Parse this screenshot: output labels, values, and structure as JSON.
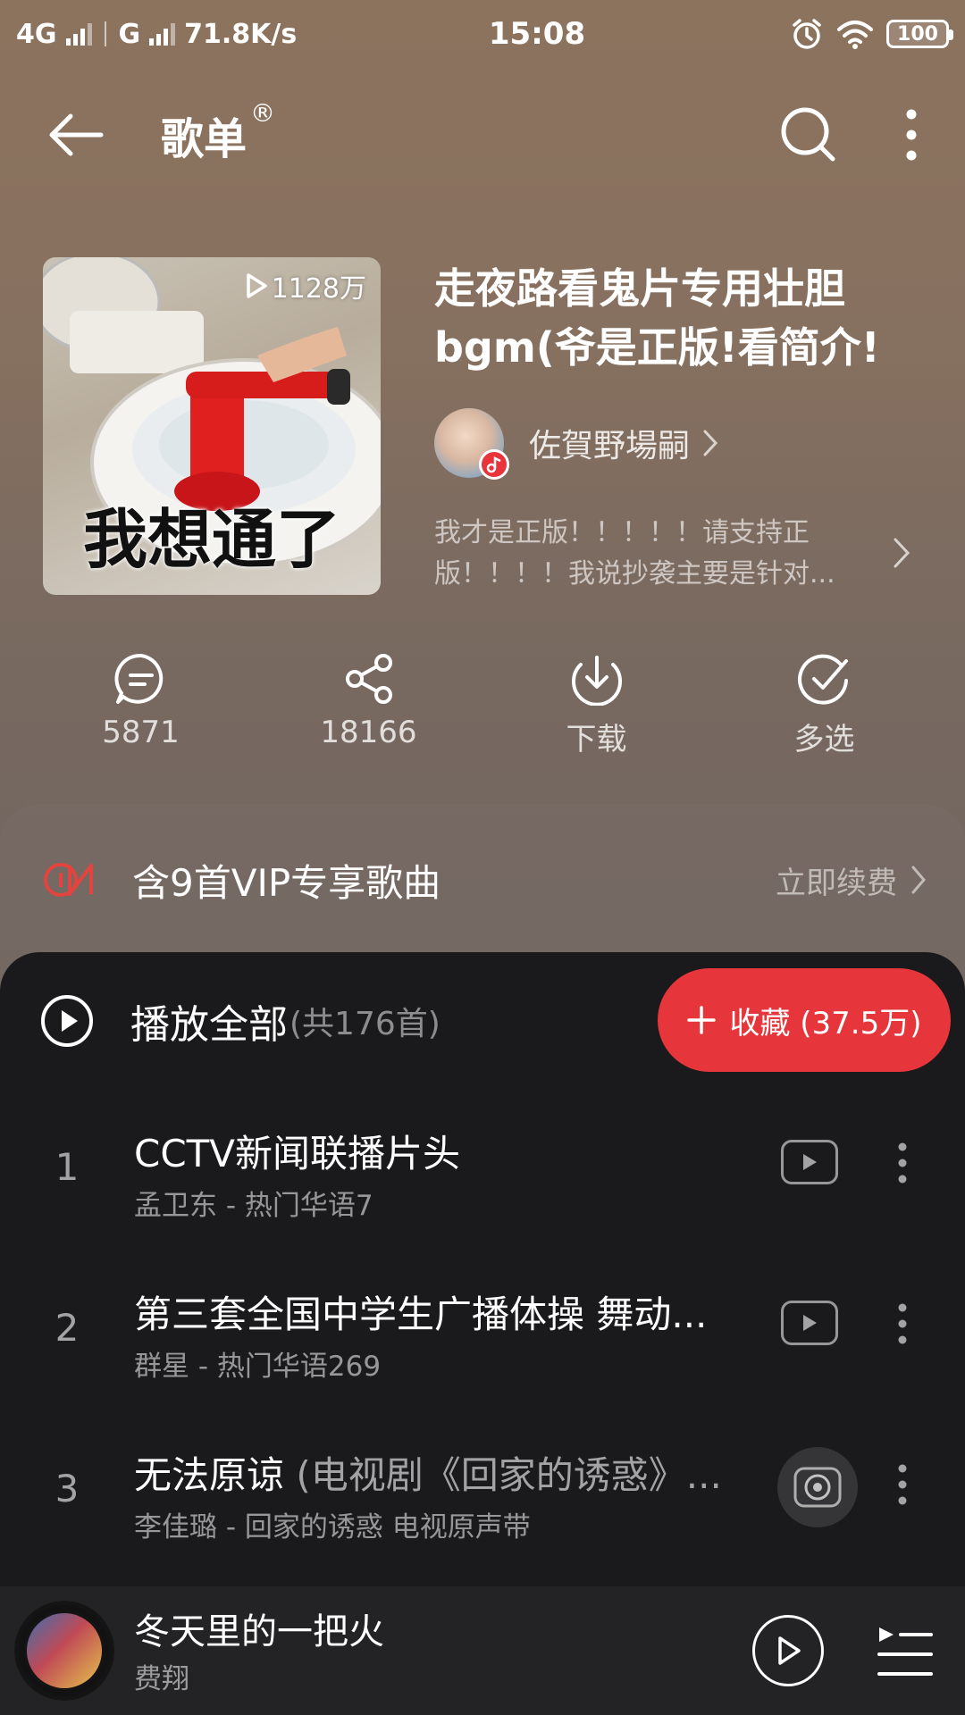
{
  "status_bar": {
    "net1": "4G",
    "net2": "G",
    "speed": "71.8K/s",
    "time": "15:08",
    "battery": "100"
  },
  "header": {
    "title": "歌单",
    "title_mark": "®"
  },
  "playlist": {
    "play_count": "1128万",
    "cover_caption": "我想通了",
    "title": "走夜路看鬼片专用壮胆bgm(爷是正版!看简介!",
    "creator": "佐賀野場嗣",
    "description_line1": "我才是正版！！！！！请支持正",
    "description_line2": "版！！！！我说抄袭主要是针对..."
  },
  "actions": [
    {
      "label": "5871",
      "icon": "comment-icon"
    },
    {
      "label": "18166",
      "icon": "share-icon"
    },
    {
      "label": "下载",
      "icon": "download-icon"
    },
    {
      "label": "多选",
      "icon": "multi-select-icon"
    }
  ],
  "vip": {
    "text": "含9首VIP专享歌曲",
    "renew": "立即续费"
  },
  "play_all": {
    "label": "播放全部",
    "count": "(共176首)",
    "collect": "收藏 (37.5万)"
  },
  "songs": [
    {
      "index": "1",
      "title": "CCTV新闻联播片头",
      "title_extra": "",
      "sub": "孟卫东 - 热门华语7",
      "state": "mv"
    },
    {
      "index": "2",
      "title": "第三套全国中学生广播体操 舞动...",
      "title_extra": "",
      "sub": "群星 - 热门华语269",
      "state": "mv"
    },
    {
      "index": "3",
      "title": "无法原谅",
      "title_extra": " (电视剧《回家的诱惑》...",
      "sub": "李佳璐 - 回家的诱惑 电视原声带",
      "state": "playing"
    }
  ],
  "mini_player": {
    "title": "冬天里的一把火",
    "artist": "费翔"
  },
  "colors": {
    "accent_red": "#e6363b",
    "panel_dark": "#1a1a1c",
    "header_bg": "#8c735e"
  }
}
